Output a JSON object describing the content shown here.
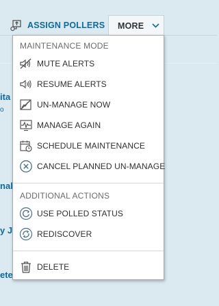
{
  "toolbar": {
    "assign_label": "ASSIGN POLLERS",
    "more_label": "MORE"
  },
  "background": {
    "row1": "ita",
    "row1_sub": "o",
    "row2": "nal",
    "row3": "y Ja",
    "row4": "ete"
  },
  "menu": {
    "maintenance_title": "MAINTENANCE MODE",
    "maintenance_items": [
      {
        "label": "MUTE ALERTS",
        "icon": "mute-alerts-icon"
      },
      {
        "label": "RESUME ALERTS",
        "icon": "resume-alerts-icon"
      },
      {
        "label": "UN-MANAGE NOW",
        "icon": "unmanage-icon"
      },
      {
        "label": "MANAGE AGAIN",
        "icon": "manage-again-icon"
      },
      {
        "label": "SCHEDULE MAINTENANCE",
        "icon": "schedule-maintenance-icon"
      },
      {
        "label": "CANCEL PLANNED UN-MANAGE",
        "icon": "cancel-circle-icon"
      }
    ],
    "additional_title": "ADDITIONAL ACTIONS",
    "additional_items": [
      {
        "label": "USE POLLED STATUS",
        "icon": "polled-status-icon"
      },
      {
        "label": "REDISCOVER",
        "icon": "rediscover-icon"
      }
    ],
    "delete_label": "DELETE"
  },
  "colors": {
    "accent": "#0f6a9a",
    "background": "#dbe9f1",
    "icon": "#555555"
  }
}
